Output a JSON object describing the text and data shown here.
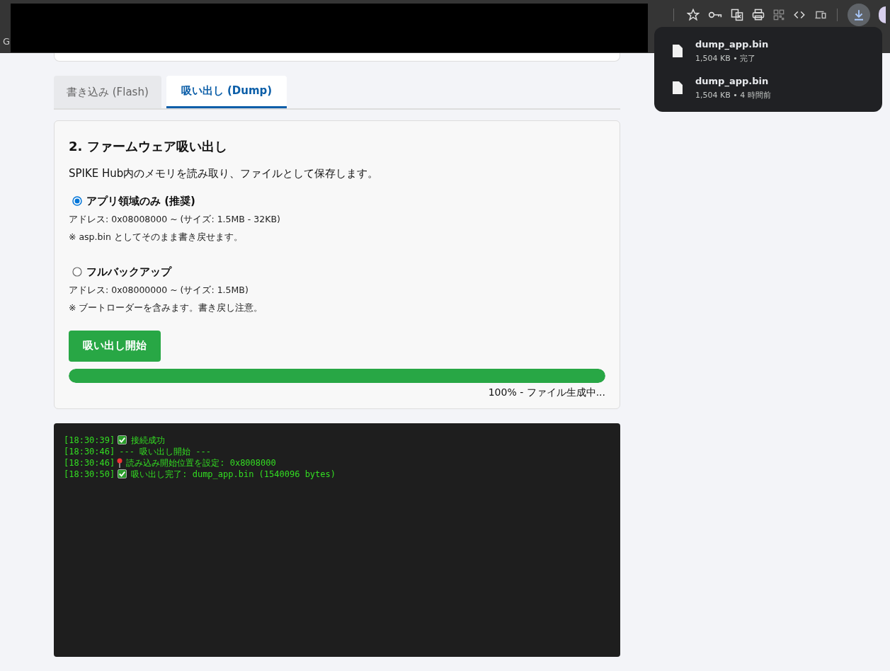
{
  "browser": {
    "bookmarks": [
      {
        "label": "G"
      }
    ]
  },
  "downloads": [
    {
      "filename": "dump_app.bin",
      "detail": "1,504 KB • 完了"
    },
    {
      "filename": "dump_app.bin",
      "detail": "1,504 KB • 4 時間前"
    }
  ],
  "tabs": [
    {
      "label": "書き込み (Flash)",
      "selected": false
    },
    {
      "label": "吸い出し (Dump)",
      "selected": true
    }
  ],
  "section": {
    "title": "2. ファームウェア吸い出し",
    "description": "SPIKE Hub内のメモリを読み取り、ファイルとして保存します。",
    "options": [
      {
        "label": "アプリ領域のみ (推奨)",
        "selected": true,
        "address": "アドレス: 0x08008000 ~ (サイズ: 1.5MB - 32KB)",
        "note": "※ asp.bin としてそのまま書き戻せます。"
      },
      {
        "label": "フルバックアップ",
        "selected": false,
        "address": "アドレス: 0x08000000 ~ (サイズ: 1.5MB)",
        "note": "※ ブートローダーを含みます。書き戻し注意。"
      }
    ],
    "button": "吸い出し開始",
    "progress": {
      "level": 1,
      "text": "100% - ファイル生成中..."
    }
  },
  "log": [
    {
      "time": "[18:30:39]",
      "kind": "check",
      "message": "接続成功"
    },
    {
      "time": "[18:30:46]",
      "kind": "plain",
      "message": "--- 吸い出し開始 ---"
    },
    {
      "time": "[18:30:46]",
      "kind": "pin",
      "message": "読み込み開始位置を設定: 0x8008000"
    },
    {
      "time": "[18:30:50]",
      "kind": "check",
      "message": "吸い出し完了: dump_app.bin (1540096 bytes)"
    }
  ]
}
